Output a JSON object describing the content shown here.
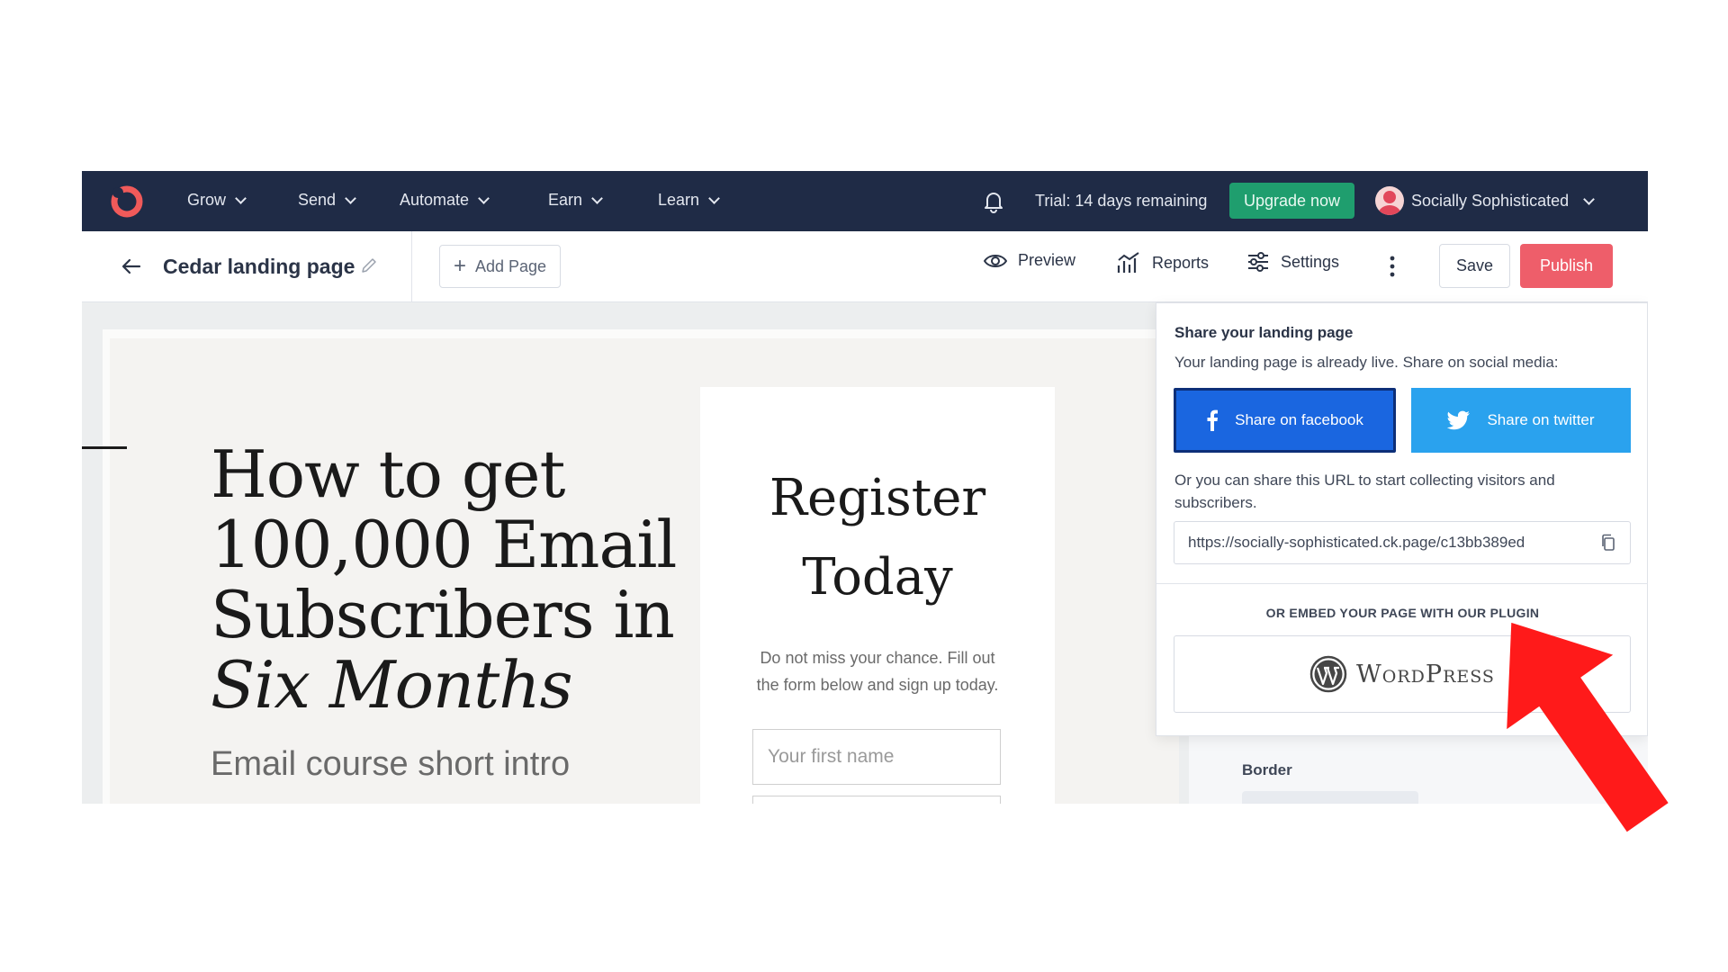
{
  "topnav": {
    "items": [
      {
        "label": "Grow"
      },
      {
        "label": "Send"
      },
      {
        "label": "Automate"
      },
      {
        "label": "Earn"
      },
      {
        "label": "Learn"
      }
    ],
    "trial_text": "Trial: 14 days remaining",
    "upgrade_label": "Upgrade now",
    "account_name": "Socially Sophisticated"
  },
  "toolbar": {
    "page_name": "Cedar landing page",
    "add_page_label": "Add Page",
    "preview_label": "Preview",
    "reports_label": "Reports",
    "settings_label": "Settings",
    "save_label": "Save",
    "publish_label": "Publish"
  },
  "landing": {
    "title_line1": "How to get",
    "title_line2": "100,000 Email",
    "title_line3": "Subscribers in",
    "title_italic": "Six Months",
    "intro": "Email course short intro",
    "register_line1": "Register",
    "register_line2": "Today",
    "register_desc": "Do not miss your chance. Fill out the form below and sign up today.",
    "first_name_placeholder": "Your first name"
  },
  "side_panel": {
    "border_label": "Border"
  },
  "share": {
    "title": "Share your landing page",
    "description": "Your landing page is already live. Share on social media:",
    "facebook_label": "Share on facebook",
    "twitter_label": "Share on twitter",
    "url_note": "Or you can share this URL to start collecting visitors and subscribers.",
    "url": "https://socially-sophisticated.ck.page/c13bb389ed",
    "embed_label": "OR EMBED YOUR PAGE WITH OUR PLUGIN",
    "wordpress_label": "WordPress"
  },
  "colors": {
    "nav_bg": "#1f2b46",
    "upgrade": "#1f9e6e",
    "publish": "#ee5e6a",
    "facebook": "#1a66e0",
    "twitter": "#2aa2ee",
    "annotation_arrow": "#ff1a1a"
  }
}
